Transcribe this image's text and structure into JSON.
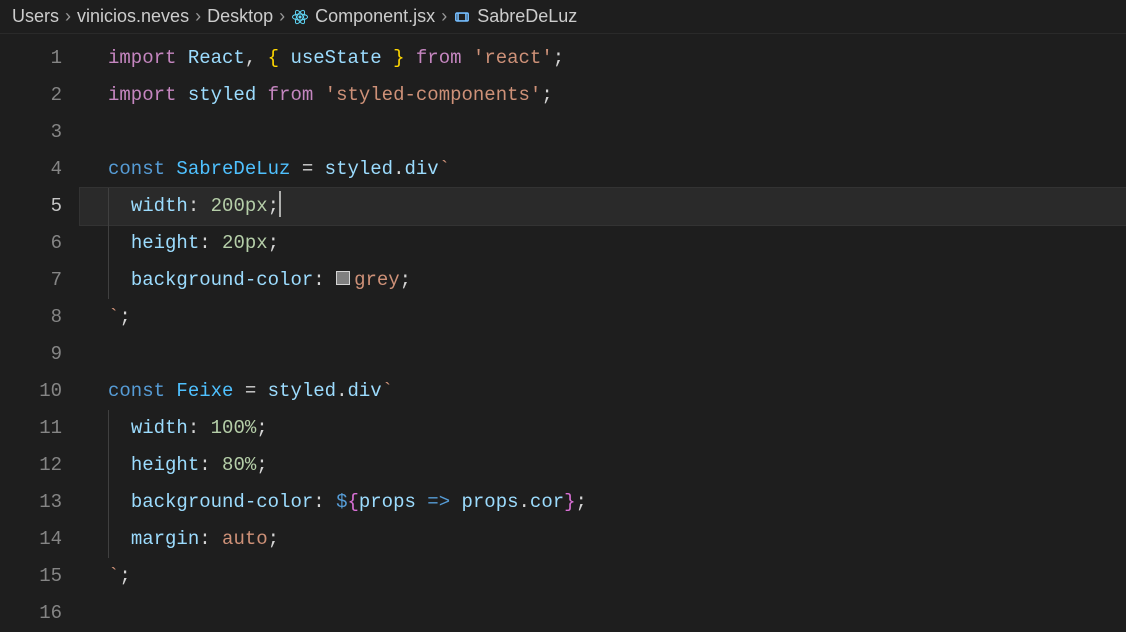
{
  "breadcrumbs": {
    "items": [
      {
        "label": "Users"
      },
      {
        "label": "vinicios.neves"
      },
      {
        "label": "Desktop"
      },
      {
        "label": "Component.jsx",
        "icon": "react"
      },
      {
        "label": "SabreDeLuz",
        "icon": "symbol-variable"
      }
    ],
    "sep": "›"
  },
  "icons": {
    "react_color": "#61dafb",
    "symbol_color": "#75beff"
  },
  "editor": {
    "active_line": 5,
    "lines": [
      1,
      2,
      3,
      4,
      5,
      6,
      7,
      8,
      9,
      10,
      11,
      12,
      13,
      14,
      15,
      16
    ]
  },
  "code": {
    "l1": {
      "import": "import",
      "react": "React",
      "comma": ", ",
      "lb": "{ ",
      "use": "useState",
      "rb": " }",
      "from": "from",
      "str": "'react'",
      "semi": ";"
    },
    "l2": {
      "import": "import",
      "styled": "styled",
      "from": "from",
      "str": "'styled-components'",
      "semi": ";"
    },
    "l4": {
      "const": "const",
      "name": "SabreDeLuz",
      "eq": " = ",
      "styled": "styled",
      "dot": ".",
      "div": "div",
      "tick": "`"
    },
    "l5": {
      "prop": "width",
      "colon": ": ",
      "val": "200px",
      "semi": ";"
    },
    "l6": {
      "prop": "height",
      "colon": ": ",
      "val": "20px",
      "semi": ";"
    },
    "l7": {
      "prop": "background-color",
      "colon": ": ",
      "val": "grey",
      "semi": ";"
    },
    "l8": {
      "tick": "`",
      "semi": ";"
    },
    "l10": {
      "const": "const",
      "name": "Feixe",
      "eq": " = ",
      "styled": "styled",
      "dot": ".",
      "div": "div",
      "tick": "`"
    },
    "l11": {
      "prop": "width",
      "colon": ": ",
      "val": "100%",
      "semi": ";"
    },
    "l12": {
      "prop": "height",
      "colon": ": ",
      "val": "80%",
      "semi": ";"
    },
    "l13": {
      "prop": "background-color",
      "colon": ": ",
      "dollar": "$",
      "lb": "{",
      "param": "props",
      "arrow": " => ",
      "obj": "props",
      "dot": ".",
      "field": "cor",
      "rb": "}",
      "semi": ";"
    },
    "l14": {
      "prop": "margin",
      "colon": ": ",
      "val": "auto",
      "semi": ";"
    },
    "l15": {
      "tick": "`",
      "semi": ";"
    }
  },
  "color_swatch": "grey"
}
